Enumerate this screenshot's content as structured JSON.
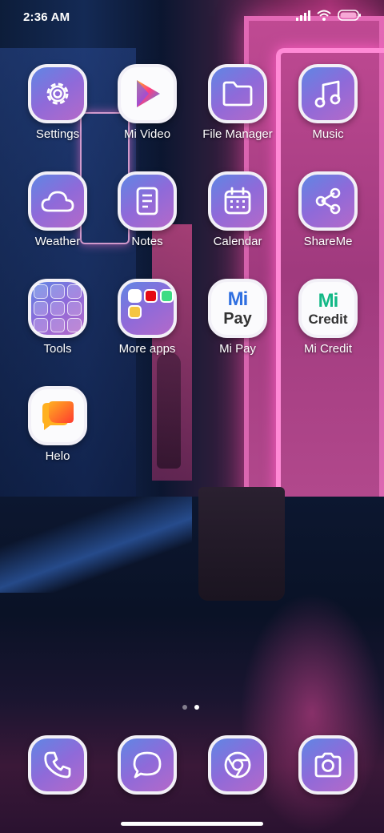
{
  "status_bar": {
    "time": "2:36 AM",
    "icons": [
      "signal-icon",
      "wifi-icon",
      "battery-icon"
    ]
  },
  "home_screen": {
    "apps": [
      {
        "label": "Settings",
        "icon": "gear-icon"
      },
      {
        "label": "Mi Video",
        "icon": "play-icon"
      },
      {
        "label": "File Manager",
        "icon": "folder-icon"
      },
      {
        "label": "Music",
        "icon": "music-note-icon"
      },
      {
        "label": "Weather",
        "icon": "cloud-icon"
      },
      {
        "label": "Notes",
        "icon": "notepad-icon"
      },
      {
        "label": "Calendar",
        "icon": "calendar-icon"
      },
      {
        "label": "ShareMe",
        "icon": "share-icon"
      },
      {
        "label": "Tools",
        "icon": "folder-grid-icon"
      },
      {
        "label": "More apps",
        "icon": "folder-grid-icon"
      },
      {
        "label": "Mi Pay",
        "icon": "mi-pay-logo",
        "logo_top": "Mi",
        "logo_bottom": "Pay"
      },
      {
        "label": "Mi Credit",
        "icon": "mi-credit-logo",
        "logo_top": "Mi",
        "logo_bottom": "Credit"
      },
      {
        "label": "Helo",
        "icon": "helo-chat-icon"
      }
    ],
    "page_count": 2,
    "active_page": 2
  },
  "dock": [
    {
      "name": "phone",
      "icon": "phone-icon"
    },
    {
      "name": "messages",
      "icon": "chat-bubble-icon"
    },
    {
      "name": "browser",
      "icon": "chrome-icon"
    },
    {
      "name": "camera",
      "icon": "camera-icon"
    }
  ],
  "colors": {
    "icon_gradient_start": "#5f86e4",
    "icon_gradient_end": "#b469c9",
    "icon_border": "#f2f0f7",
    "mi_pay_blue": "#2f6fe0",
    "mi_credit_green": "#12b886"
  }
}
